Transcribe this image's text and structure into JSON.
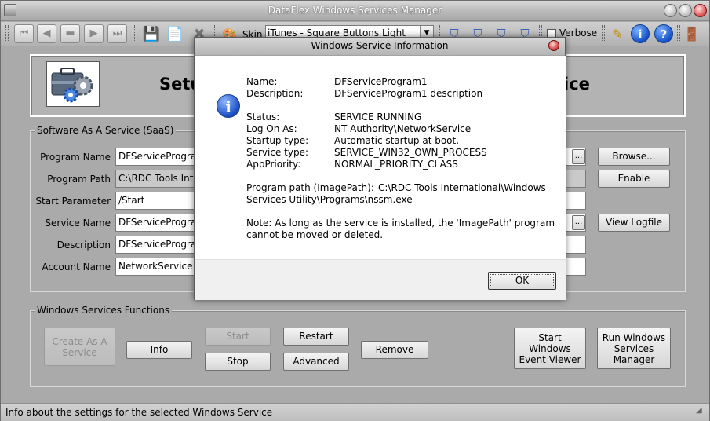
{
  "window": {
    "title": "DataFlex Windows Services Manager"
  },
  "toolbar": {
    "skin_label": "Skin",
    "skin_value": "iTunes - Square Buttons Light",
    "verbose_label": "Verbose",
    "icons": [
      "first-record-icon",
      "previous-record-icon",
      "stop-icon",
      "next-record-icon",
      "last-record-icon",
      "save-icon",
      "new-icon",
      "delete-icon",
      "skin-icon",
      "shield-icon",
      "info-icon",
      "help-icon",
      "exit-icon"
    ]
  },
  "header": {
    "title_left": "Setu",
    "title_right": "ice"
  },
  "saas": {
    "group_label": "Software As A Service (SaaS)",
    "program_name_label": "Program Name",
    "program_name_value": "DFServiceProgram",
    "program_path_label": "Program Path",
    "program_path_value": "C:\\RDC Tools Inte",
    "start_parameter_label": "Start Parameter",
    "start_parameter_value": "/Start",
    "service_name_label": "Service Name",
    "service_name_value": "DFServiceProgram",
    "description_label": "Description",
    "description_value": "DFServiceProgram",
    "account_name_label": "Account Name",
    "account_name_value": "NetworkService",
    "browse_button": "Browse...",
    "enable_button": "Enable",
    "view_logfile_button": "View Logfile",
    "dots": "..."
  },
  "functions": {
    "group_label": "Windows Services Functions",
    "create_service": "Create As A Service",
    "info": "Info",
    "start": "Start",
    "stop": "Stop",
    "restart": "Restart",
    "advanced": "Advanced",
    "remove": "Remove",
    "event_viewer": "Start Windows Event Viewer",
    "services_manager": "Run Windows Services Manager"
  },
  "statusbar": {
    "text": "Info about the settings for the selected Windows Service"
  },
  "dialog": {
    "title": "Windows Service Information",
    "name_label": "Name:",
    "name_value": "DFServiceProgram1",
    "description_label": "Description:",
    "description_value": "DFServiceProgram1 description",
    "status_label": "Status:",
    "status_value": "SERVICE RUNNING",
    "logon_label": "Log On As:",
    "logon_value": "NT Authority\\NetworkService",
    "startup_label": "Startup type:",
    "startup_value": "Automatic startup at boot.",
    "service_type_label": "Service type:",
    "service_type_value": "SERVICE_WIN32_OWN_PROCESS",
    "priority_label": "AppPriority:",
    "priority_value": "NORMAL_PRIORITY_CLASS",
    "path_label": "Program path (ImagePath):",
    "path_value_line1": "C:\\RDC Tools International\\Windows",
    "path_value_line2": "Services Utility\\Programs\\nssm.exe",
    "note_line1": "Note: As long as the service is installed, the 'ImagePath' program",
    "note_line2": "cannot be moved or deleted.",
    "ok_button": "OK"
  }
}
